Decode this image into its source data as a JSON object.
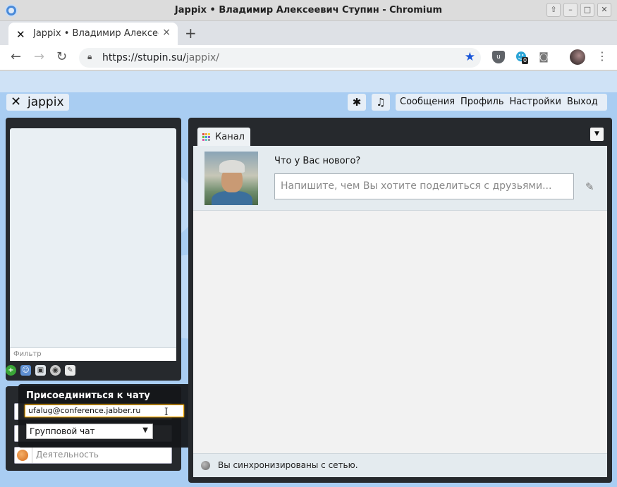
{
  "window": {
    "title": "Jappix • Владимир Алексеевич Ступин - Chromium",
    "controls": [
      "up-icon",
      "minimize-icon",
      "maximize-icon",
      "close-icon"
    ]
  },
  "tab": {
    "title": "Jappix • Владимир Алексеевич Ступин",
    "favicon": "jappix-icon",
    "close": "×",
    "new_tab": "+"
  },
  "toolbar": {
    "back": "←",
    "forward": "→",
    "reload": "↻",
    "url_host": "https://stupin.su/",
    "url_path": "jappix/",
    "star": "★",
    "ext_badge": "0",
    "menu": "⋮"
  },
  "app": {
    "logo_mark": "✕",
    "logo_text": "jappix",
    "btn_asterisk": "✱",
    "btn_music": "♫",
    "nav": [
      "Сообщения",
      "Профиль",
      "Настройки",
      "Выход"
    ]
  },
  "roster": {
    "filter_placeholder": "Фильтр"
  },
  "presence": {
    "activity_placeholder": "Деятельность"
  },
  "join_chat": {
    "title": "Присоединиться к чату",
    "input_value": "ufalug@conference.jabber.ru",
    "type_selected": "Групповой чат",
    "cursor": "I"
  },
  "channel": {
    "tab_label": "Канал",
    "menu_arrow": "▼",
    "whats_new": "Что у Вас нового?",
    "post_placeholder": "Напишите, чем Вы хотите поделиться с друзьями...",
    "status_text": "Вы синхронизированы с сетью."
  },
  "colors": {
    "page_bg": "#a9cdf2",
    "panel_dark": "#26292d",
    "accent_star": "#1a56d8",
    "focus_orange": "#f0a500"
  }
}
